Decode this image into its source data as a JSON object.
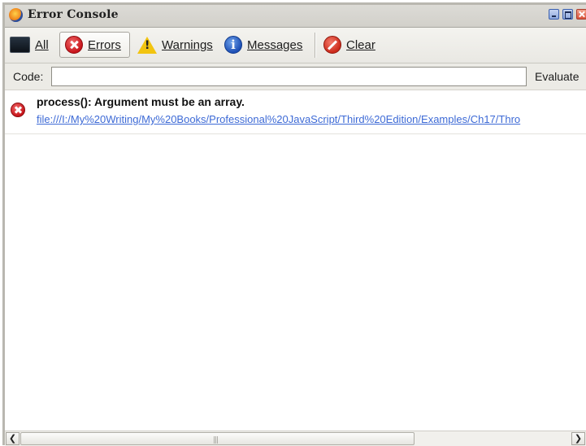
{
  "window": {
    "title": "Error Console",
    "controls": [
      "minimize-icon",
      "maximize-icon",
      "close-icon"
    ]
  },
  "toolbar": {
    "all_label": "All",
    "errors_label": "Errors",
    "warnings_label": "Warnings",
    "messages_label": "Messages",
    "clear_label": "Clear",
    "selected": "Errors"
  },
  "codebar": {
    "code_label": "Code:",
    "code_value": "",
    "evaluate_label": "Evaluate"
  },
  "entries": [
    {
      "type": "error",
      "icon": "error-icon",
      "message": "process(): Argument must be an array.",
      "source": "file:///I:/My%20Writing/My%20Books/Professional%20JavaScript/Third%20Edition/Examples/Ch17/Thro"
    }
  ],
  "colors": {
    "titlebar": "#d6d4ce",
    "toolbar": "#efeeea",
    "link": "#3d6ad6",
    "error_red": "#c8151b"
  }
}
